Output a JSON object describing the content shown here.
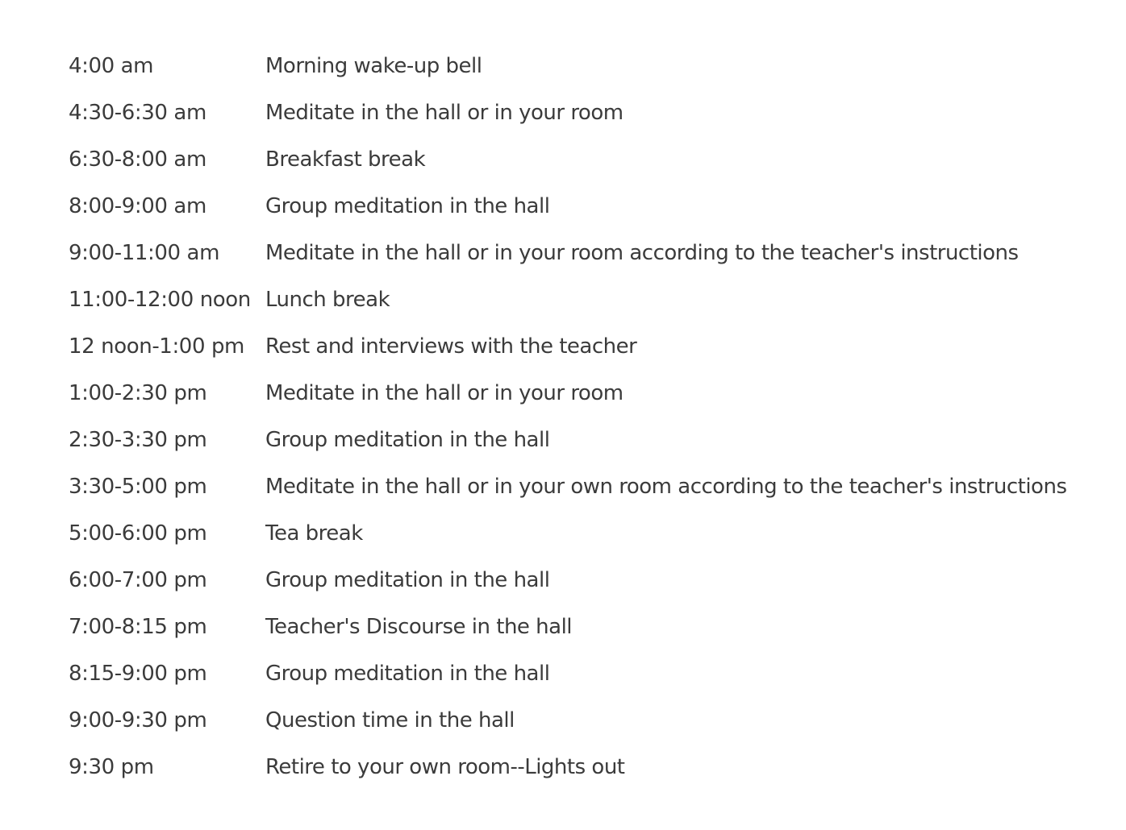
{
  "schedule": {
    "rows": [
      {
        "time": "4:00 am",
        "activity": "Morning wake-up bell"
      },
      {
        "time": "4:30-6:30 am",
        "activity": "Meditate in the hall or in your room"
      },
      {
        "time": "6:30-8:00 am",
        "activity": "Breakfast break"
      },
      {
        "time": "8:00-9:00 am",
        "activity": "Group meditation in the hall"
      },
      {
        "time": "9:00-11:00 am",
        "activity": "Meditate in the hall or in your room according to the teacher's instructions"
      },
      {
        "time": "11:00-12:00 noon",
        "activity": "Lunch break"
      },
      {
        "time": "12 noon-1:00 pm",
        "activity": "Rest and interviews with the teacher"
      },
      {
        "time": "1:00-2:30 pm",
        "activity": "Meditate in the hall or in your room"
      },
      {
        "time": "2:30-3:30 pm",
        "activity": "Group meditation in the hall"
      },
      {
        "time": "3:30-5:00 pm",
        "activity": "Meditate in the hall or in your own room according to the teacher's instructions"
      },
      {
        "time": "5:00-6:00 pm",
        "activity": "Tea break"
      },
      {
        "time": "6:00-7:00 pm",
        "activity": "Group meditation in the hall"
      },
      {
        "time": "7:00-8:15 pm",
        "activity": "Teacher's Discourse in the hall"
      },
      {
        "time": "8:15-9:00 pm",
        "activity": "Group meditation in the hall"
      },
      {
        "time": "9:00-9:30 pm",
        "activity": "Question time in the hall"
      },
      {
        "time": "9:30 pm",
        "activity": "Retire to your own room--Lights out"
      }
    ]
  }
}
